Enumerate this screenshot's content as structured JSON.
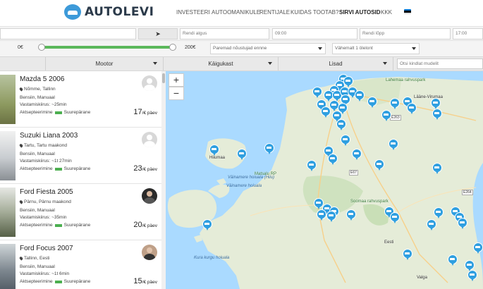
{
  "brand": {
    "name": "AUTOLEVI",
    "color": "#3d9ad9"
  },
  "nav": [
    {
      "label": "INVESTEERI"
    },
    {
      "label": "AUTOOMANIKULE"
    },
    {
      "label": "RENTIJALE"
    },
    {
      "label": "KUIDAS TOOTAB?"
    },
    {
      "label": "SIRVI AUTOSID",
      "active": true
    },
    {
      "label": "KKK"
    }
  ],
  "language_flag": [
    "#0072ce",
    "#000000",
    "#ffffff"
  ],
  "filters": {
    "rent_start_placeholder": "Rendi algus",
    "rent_start_time": "09:00",
    "rent_end_placeholder": "Rendi lõpp",
    "rent_end_time": "17:00",
    "price_min": "0€",
    "price_max": "200€",
    "price_range_selected": [
      0,
      200
    ],
    "sort_select": "Paremad nõustujad ennne",
    "days_select": "Vähemalt 1 ölelont",
    "groups": [
      "Mootor",
      "Käigukast",
      "Lisad"
    ],
    "model_search_placeholder": "Otsi kindlat mudelit"
  },
  "listings": [
    {
      "title": "Mazda 5 2006",
      "location": "Nõmme, Tallinn",
      "fuel": "Bensiin, Manuaal",
      "response": "Vastamiskiirus: ~25min",
      "acceptance_label": "Aktsepteerimine",
      "acceptance_value": "Suurepärane",
      "price": "17",
      "price_unit": "/€ päev",
      "thumb_color": "#9aa56a"
    },
    {
      "title": "Suzuki Liana 2003",
      "location": "Tartu, Tartu maakond",
      "fuel": "Bensiin, Manuaal",
      "response": "Vastamiskiirus: ~1t 27min",
      "acceptance_label": "Aktsepteerimine",
      "acceptance_value": "Suurepärane",
      "price": "23",
      "price_unit": "/€ päev",
      "thumb_color": "#c9ccd0"
    },
    {
      "title": "Ford Fiesta 2005",
      "location": "Pärnu, Pärnu maakond",
      "fuel": "Bensiin, Manuaal",
      "response": "Vastamiskiirus: ~35min",
      "acceptance_label": "Aktsepteerimine",
      "acceptance_value": "Suurepärane",
      "price": "20",
      "price_unit": "/€ päev",
      "thumb_color": "#8a9480"
    },
    {
      "title": "Ford Focus 2007",
      "location": "Tallinn, Eesti",
      "fuel": "Bensiin, Manuaal",
      "response": "Vastamiskiirus: ~1t 6min",
      "acceptance_label": "Aktsepteerimine",
      "acceptance_value": "Suurepärane",
      "price": "15",
      "price_unit": "/€ päev",
      "thumb_color": "#6f7882"
    }
  ],
  "map": {
    "zoom_in": "+",
    "zoom_out": "−",
    "labels": [
      "Lääne-Virumaa",
      "Hiiumaa",
      "Väinamere hoiuala (Hiiu)",
      "Väinamere hoiuala",
      "Matsalu RP",
      "Soomaa rahvuspark",
      "Kura kurgu hoiuala",
      "Valga",
      "Eesti",
      "Lahemaa rahvuspark",
      "E263",
      "E264",
      "E67"
    ]
  }
}
